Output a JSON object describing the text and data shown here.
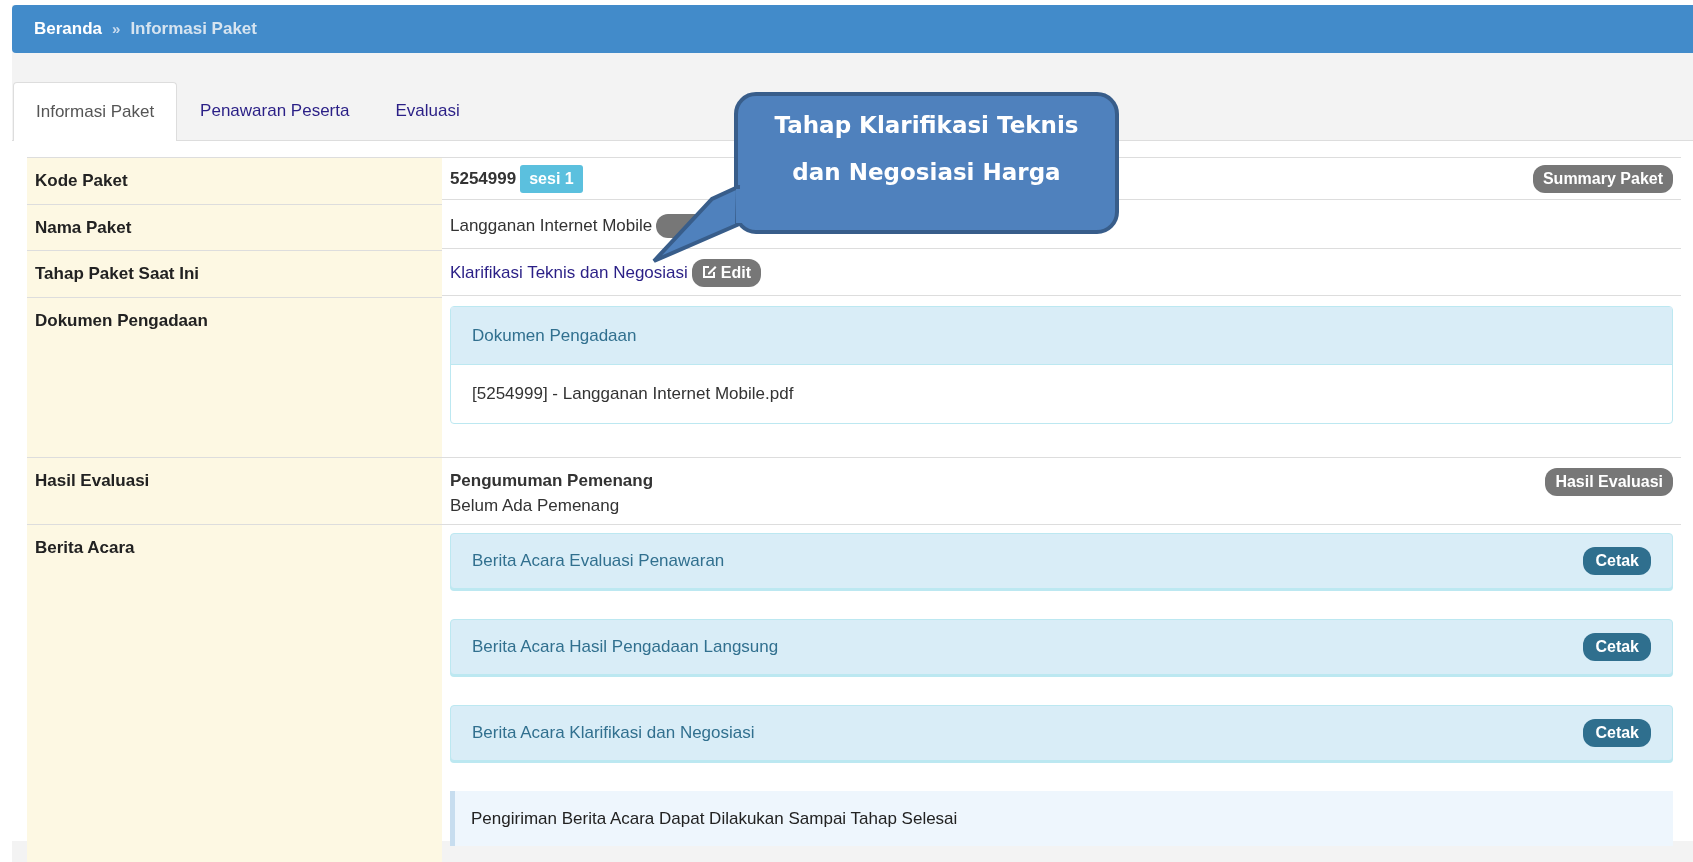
{
  "breadcrumb": [
    {
      "label": "Beranda",
      "current": false
    },
    {
      "label": "Informasi Paket",
      "current": true
    }
  ],
  "breadcrumb_separator": "»",
  "tabs": [
    {
      "label": "Informasi Paket",
      "selected": true
    },
    {
      "label": "Penawaran Peserta",
      "selected": false
    },
    {
      "label": "Evaluasi",
      "selected": false
    }
  ],
  "rows": [
    {
      "kind": "code",
      "label": "Kode Paket",
      "value": "5254999",
      "badge": "sesi 1",
      "action": "Summary Paket"
    },
    {
      "kind": "name",
      "label": "Nama Paket",
      "value": "Langganan Internet Mobile"
    },
    {
      "kind": "stage",
      "label": "Tahap Paket Saat Ini",
      "value": "Klarifikasi Teknis dan Negosiasi",
      "action": "Edit"
    },
    {
      "kind": "documents",
      "label": "Dokumen Pengadaan",
      "panel_title": "Dokumen Pengadaan",
      "files": [
        "[5254999] - Langganan Internet Mobile.pdf"
      ]
    },
    {
      "kind": "result",
      "label": "Hasil Evaluasi",
      "title": "Pengumuman Pemenang",
      "value": "Belum Ada Pemenang",
      "action": "Hasil Evaluasi"
    },
    {
      "kind": "reports",
      "label": "Berita Acara",
      "items": [
        {
          "title": "Berita Acara Evaluasi Penawaran",
          "action": "Cetak"
        },
        {
          "title": "Berita Acara Hasil Pengadaan Langsung",
          "action": "Cetak"
        },
        {
          "title": "Berita Acara Klarifikasi dan Negosiasi",
          "action": "Cetak"
        }
      ],
      "note": "Pengiriman Berita Acara Dapat Dilakukan Sampai Tahap Selesai"
    }
  ],
  "callout": {
    "text": "Tahap Klarifikasi Teknis dan Negosiasi Harga"
  }
}
